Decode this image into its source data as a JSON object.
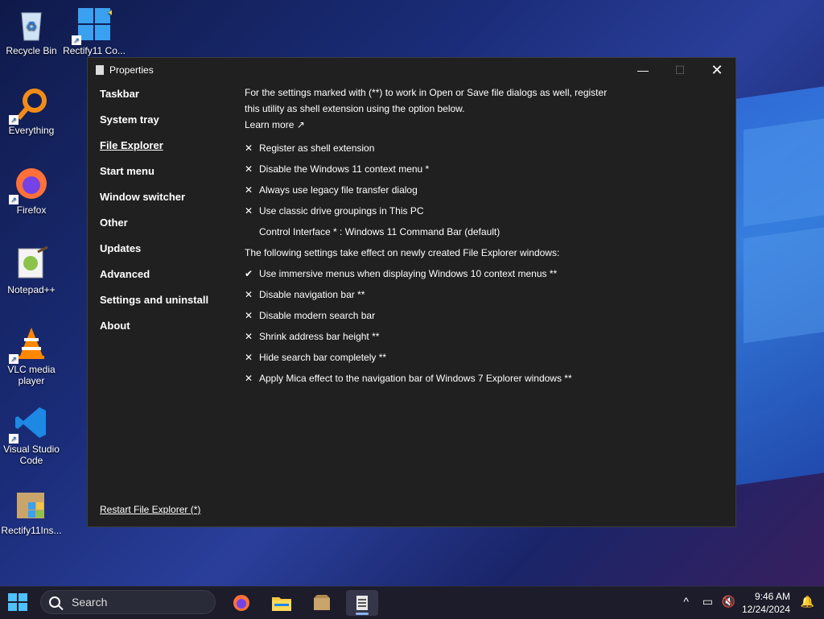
{
  "desktop": {
    "icons": [
      {
        "label": "Recycle Bin"
      },
      {
        "label": "Rectify11 Co..."
      },
      {
        "label": "Everything"
      },
      {
        "label": "Firefox"
      },
      {
        "label": "Notepad++"
      },
      {
        "label": "VLC media player"
      },
      {
        "label": "Visual Studio Code"
      },
      {
        "label": "Rectify11Ins..."
      }
    ]
  },
  "window": {
    "title": "Properties",
    "controls": {
      "minimize": "—",
      "maximize": "☐",
      "close": "✕"
    },
    "sidebar": [
      {
        "label": "Taskbar"
      },
      {
        "label": "System tray"
      },
      {
        "label": "File Explorer"
      },
      {
        "label": "Start menu"
      },
      {
        "label": "Window switcher"
      },
      {
        "label": "Other"
      },
      {
        "label": "Updates"
      },
      {
        "label": "Advanced"
      },
      {
        "label": "Settings and uninstall"
      },
      {
        "label": "About"
      }
    ],
    "active_section": "File Explorer",
    "restart_link": "Restart File Explorer (*)",
    "content": {
      "intro": "For the settings marked with (**) to work in Open or Save file dialogs as well, register this utility as shell extension using the option below.",
      "learn_more": "Learn more ↗",
      "options_a": [
        {
          "mark": "✕",
          "label": "Register as shell extension"
        },
        {
          "mark": "✕",
          "label": "Disable the Windows 11 context menu *"
        },
        {
          "mark": "✕",
          "label": "Always use legacy file transfer dialog"
        },
        {
          "mark": "✕",
          "label": "Use classic drive groupings in This PC"
        }
      ],
      "control_interface": "Control Interface * : Windows 11 Command Bar (default)",
      "section_label": "The following settings take effect on newly created File Explorer windows:",
      "options_b": [
        {
          "mark": "✔",
          "label": "Use immersive menus when displaying Windows 10 context menus **"
        },
        {
          "mark": "✕",
          "label": "Disable navigation bar **"
        },
        {
          "mark": "✕",
          "label": "Disable modern search bar"
        },
        {
          "mark": "✕",
          "label": "Shrink address bar height **"
        },
        {
          "mark": "✕",
          "label": "Hide search bar completely **"
        },
        {
          "mark": "✕",
          "label": "Apply Mica effect to the navigation bar of Windows 7 Explorer windows **"
        }
      ]
    }
  },
  "taskbar": {
    "search_placeholder": "Search",
    "apps": [
      "firefox-icon",
      "file-explorer-icon",
      "package-icon",
      "properties-app-icon"
    ],
    "time": "9:46 AM",
    "date": "12/24/2024",
    "tray": {
      "chevron": "^",
      "network": "▭",
      "volume": "🔇",
      "notification": "🔔"
    }
  }
}
